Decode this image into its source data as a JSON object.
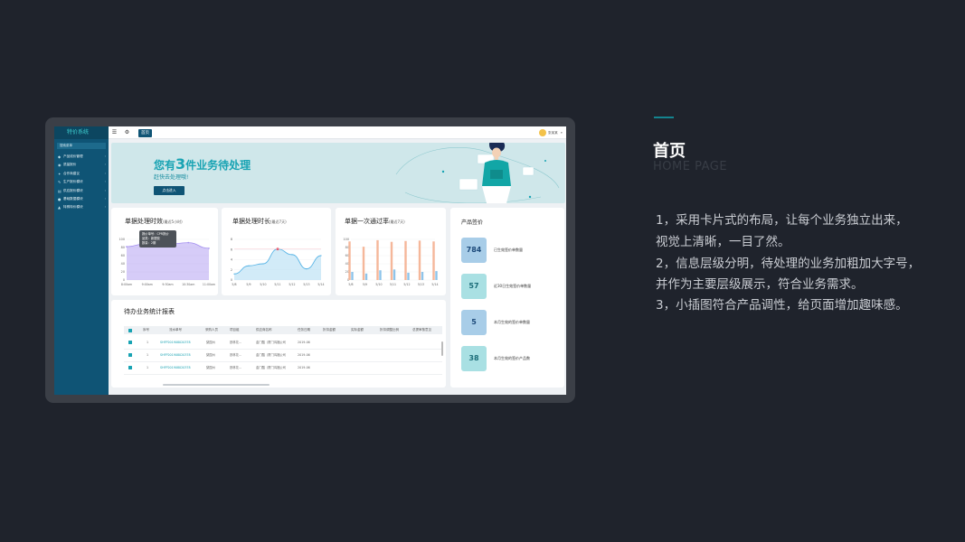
{
  "slide": {
    "title": "首页",
    "title_en": "HOME PAGE",
    "lines": [
      "1，采用卡片式的布局，让每个业务独立出来，",
      "视觉上清晰，一目了然。",
      "2，信息层级分明，待处理的业务加粗加大字号，",
      "并作为主要层级展示，符合业务需求。",
      "3，小插图符合产品调性，给页面增加趣味感。"
    ]
  },
  "app": {
    "logo": "特价系统",
    "search_placeholder": "搜索菜单",
    "sidebar": [
      {
        "label": "产品线价管理",
        "icon": "tag-icon"
      },
      {
        "label": "质量报价",
        "icon": "shield-icon"
      },
      {
        "label": "合作商建议",
        "icon": "handshake-icon"
      },
      {
        "label": "生产报价模块",
        "icon": "wrench-icon"
      },
      {
        "label": "供应报价模块",
        "icon": "file-icon"
      },
      {
        "label": "基础数据模块",
        "icon": "database-icon"
      },
      {
        "label": "特殊特价模块",
        "icon": "warning-icon"
      }
    ],
    "topbar": {
      "tab_home": "首页",
      "username": "张某某"
    },
    "banner": {
      "title_pre": "您有",
      "count": "3",
      "title_post": "件业务待处理",
      "subtitle": "赶快去处理哦!",
      "button": "点击进入"
    },
    "charts": [
      {
        "title": "单据处理时效",
        "subtitle": "(最近5小时)",
        "tooltip": [
          "报价单号：CPR报价",
          "品类：新塑胶",
          "数量：2期"
        ]
      },
      {
        "title": "单据处理时长",
        "subtitle": "(最近7天)"
      },
      {
        "title": "单据一次通过率",
        "subtitle": "(最近7天)"
      }
    ],
    "table": {
      "title": "待办业务统计报表",
      "headers": [
        "序号",
        "流水单号",
        "采购人员",
        "项目组",
        "供应商名称",
        "任务日期",
        "折扣金额",
        "实际金额",
        "折扣调整比例",
        "总提审核意见"
      ],
      "rows": [
        {
          "idx": "1",
          "serial": "SHFP201908020378",
          "buyer": "梨园州",
          "team": "铁林花...",
          "supplier": "金门酷（厦门鸿福公司",
          "date": "2019-06"
        },
        {
          "idx": "1",
          "serial": "SHFP201908020378",
          "buyer": "梨园州",
          "team": "铁林花...",
          "supplier": "金门酷（厦门鸿福公司",
          "date": "2019-06"
        },
        {
          "idx": "1",
          "serial": "SHFP201908020378",
          "buyer": "梨园州",
          "team": "铁林花...",
          "supplier": "金门酷（厦门鸿福公司",
          "date": "2019-06"
        }
      ]
    },
    "prices": {
      "title": "产品签价",
      "items": [
        {
          "value": "784",
          "label": "已生效签价单数量",
          "bg": "#a8cde8",
          "fg": "#1d4a7a"
        },
        {
          "value": "57",
          "label": "近30日生效签价单数量",
          "bg": "#a9e0e3",
          "fg": "#1b6c78"
        },
        {
          "value": "5",
          "label": "本月生效的签价单数量",
          "bg": "#a8cde8",
          "fg": "#1d4a7a"
        },
        {
          "value": "38",
          "label": "本月生效的签价产品数",
          "bg": "#a9e0e3",
          "fg": "#1b6c78"
        }
      ]
    }
  },
  "chart_data": [
    {
      "type": "area",
      "categories": [
        "8:00am",
        "9:00am",
        "9:30am",
        "10:30am",
        "11:00am"
      ],
      "values": [
        82,
        90,
        88,
        92,
        78
      ],
      "ylim": [
        0,
        100
      ],
      "yticks": [
        "0",
        "20",
        "40",
        "60",
        "80",
        "100"
      ],
      "color": "#a48ff0"
    },
    {
      "type": "line",
      "categories": [
        "5/8",
        "5/9",
        "5/10",
        "5/11",
        "5/12",
        "5/13",
        "5/14"
      ],
      "values": [
        1.2,
        2.8,
        3.2,
        6.1,
        5.0,
        2.2,
        4.8
      ],
      "ylim": [
        0,
        8
      ],
      "yticks": [
        "0",
        "2",
        "4",
        "6",
        "8"
      ],
      "color": "#5ab5e6"
    },
    {
      "type": "bar",
      "categories": [
        "5/8",
        "5/9",
        "5/10",
        "5/11",
        "5/12",
        "5/13",
        "5/14"
      ],
      "ylim": [
        0,
        100
      ],
      "yticks": [
        "0",
        "20",
        "40",
        "60",
        "80",
        "100"
      ],
      "series": [
        {
          "values": [
            95,
            82,
            98,
            94,
            96,
            97,
            95
          ],
          "color": "#f5b79a"
        },
        {
          "values": [
            20,
            16,
            24,
            26,
            18,
            20,
            22
          ],
          "color": "#8ec4ea"
        }
      ]
    }
  ]
}
